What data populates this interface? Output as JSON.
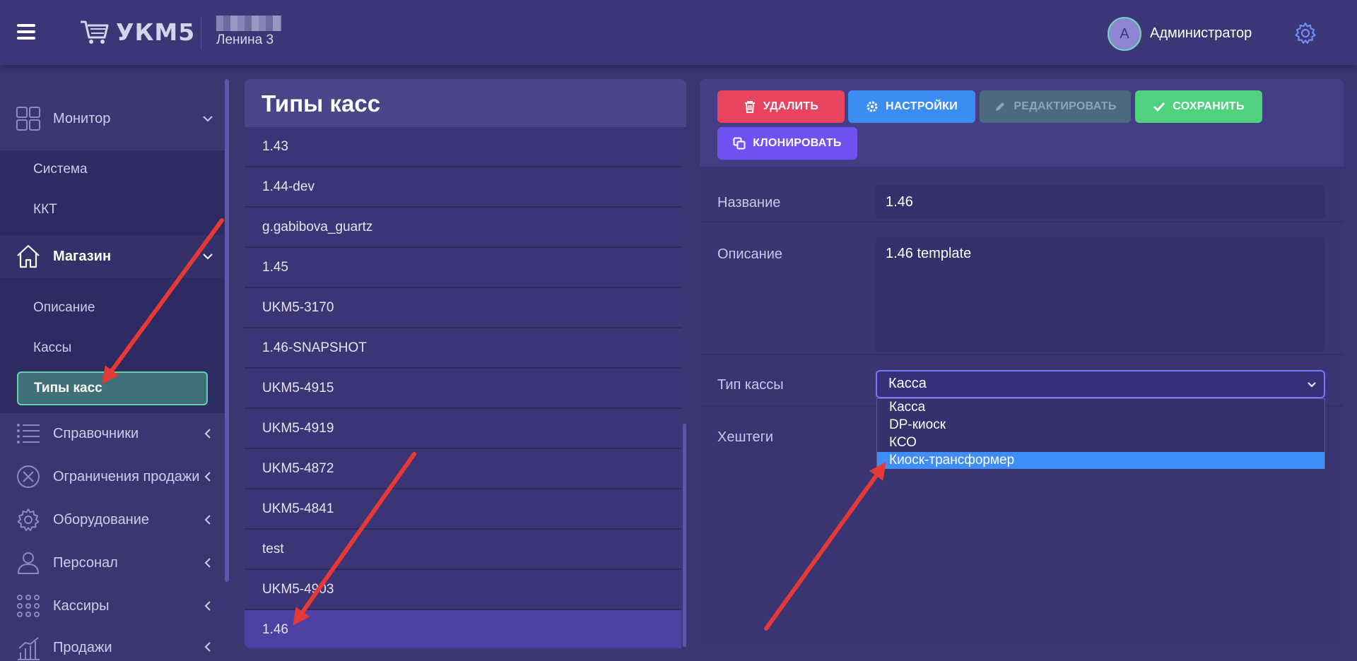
{
  "header": {
    "logo_text": "УКМ5",
    "store_name": "Ленина 3",
    "avatar_letter": "А",
    "user_name": "Администратор"
  },
  "sidebar": {
    "items": [
      {
        "label": "Монитор",
        "icon": "dashboard-icon"
      },
      {
        "label": "Магазин",
        "icon": "home-icon"
      },
      {
        "label": "Справочники",
        "icon": "list-icon"
      },
      {
        "label": "Ограничения продажи",
        "icon": "cancel-circle-icon"
      },
      {
        "label": "Оборудование",
        "icon": "gear-icon"
      },
      {
        "label": "Персонал",
        "icon": "person-icon"
      },
      {
        "label": "Кассиры",
        "icon": "grid-dots-icon"
      },
      {
        "label": "Продажи",
        "icon": "bar-chart-icon"
      }
    ],
    "monitor_sub": [
      "Система",
      "ККТ"
    ],
    "store_sub": [
      "Описание",
      "Кассы",
      "Типы касс"
    ]
  },
  "list": {
    "title": "Типы касс",
    "rows": [
      "1.43",
      "1.44-dev",
      "g.gabibova_guartz",
      "1.45",
      "UKM5-3170",
      "1.46-SNAPSHOT",
      "UKM5-4915",
      "UKM5-4919",
      "UKM5-4872",
      "UKM5-4841",
      "test",
      "UKM5-4903",
      "1.46"
    ],
    "selected": "1.46"
  },
  "toolbar": {
    "delete_label": "УДАЛИТЬ",
    "settings_label": "НАСТРОЙКИ",
    "edit_label": "РЕДАКТИРОВАТЬ",
    "save_label": "СОХРАНИТЬ",
    "clone_label": "КЛОНИРОВАТЬ"
  },
  "form": {
    "name_label": "Название",
    "name_value": "1.46",
    "description_label": "Описание",
    "description_value": "1.46 template",
    "type_label": "Тип кассы",
    "type_value": "Касса",
    "type_options": [
      "Касса",
      "DP-киоск",
      "КСО",
      "Киоск-трансформер"
    ],
    "type_highlighted": "Киоск-трансформер",
    "hashtags_label": "Хештеги"
  },
  "colors": {
    "background": "#3b3572",
    "delete": "#e9445f",
    "settings": "#3b8df2",
    "save": "#4fd17e",
    "clone": "#7051f2",
    "active_item_border": "#62d3a8",
    "annotation_arrow": "#e53935"
  }
}
